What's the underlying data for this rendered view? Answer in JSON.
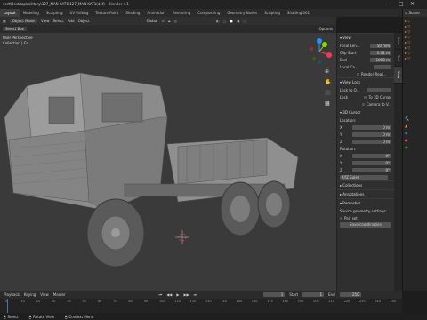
{
  "window": {
    "title": "vert\\Desktop\\military\\127_MAN KAT1\\127_MAN KAT1(def) - Blender 4.1"
  },
  "workspaces": {
    "tabs": [
      "Layout",
      "Modeling",
      "Sculpting",
      "UV Editing",
      "Texture Paint",
      "Shading",
      "Animation",
      "Rendering",
      "Compositing",
      "Geometry Nodes",
      "Scripting",
      "Shading.001"
    ],
    "active": 0
  },
  "header": {
    "view_menu": "View",
    "select_menu": "Select",
    "add_menu": "Add",
    "object_menu": "Object",
    "mode": "Object Mode",
    "orientation": "Global",
    "pivot": "Default",
    "drag": "Select Box",
    "options": "Options"
  },
  "viewport": {
    "label": "User Perspective",
    "collection": "Collection | Ga",
    "bg_color": "#3a3a3a"
  },
  "npanel": {
    "tabs": [
      "Item",
      "Tool",
      "View"
    ],
    "view_section": {
      "title": "View",
      "focal_label": "Focal Len...",
      "focal_value": "50 mm",
      "clip_start_label": "Clip Start",
      "clip_start_value": "0.01 m",
      "end_label": "End",
      "end_value": "1000 m",
      "local_camera_label": "Local Ca...",
      "render_region": "Render Regi..."
    },
    "view_lock": {
      "title": "View Lock",
      "lock_obj_label": "Lock to O...",
      "lock_label": "Lock",
      "to_cursor": "To 3D Cursor",
      "camera_to": "Camera to V..."
    },
    "cursor_section": {
      "title": "3D Cursor",
      "location": "Location:",
      "x_label": "X",
      "x_value": "0 m",
      "y_label": "Y",
      "y_value": "0 m",
      "z_label": "Z",
      "z_value": "0 m",
      "rotation": "Rotation:",
      "rx_label": "X",
      "rx_value": "0°",
      "ry_label": "Y",
      "ry_value": "0°",
      "rz_label": "Z",
      "rz_value": "0°",
      "mode": "XYZ Euler"
    },
    "collections": "Collections",
    "annotations": "Annotations",
    "remesher": {
      "title": "Remesher",
      "geom_label": "Source geometry settings:",
      "pair_label": "Pair set",
      "btn": "Save coordination"
    }
  },
  "scene": {
    "label": "Scene"
  },
  "timeline": {
    "playback": "Playback",
    "keying": "Keying",
    "view": "View",
    "marker": "Marker",
    "frame": "1",
    "start_label": "Start",
    "start_value": "1",
    "end_label": "End",
    "end_value": "250"
  },
  "ruler": {
    "ticks": [
      "0",
      "10",
      "20",
      "30",
      "40",
      "50",
      "60",
      "70",
      "80",
      "90",
      "100",
      "110",
      "120",
      "130",
      "140",
      "150",
      "160",
      "170",
      "180",
      "190",
      "200",
      "210",
      "220",
      "230",
      "240",
      "250"
    ]
  },
  "status": {
    "select": "Select",
    "rotate": "Rotate View",
    "context": "Context Menu"
  },
  "colors": {
    "accent": "#4772b3",
    "x_axis": "#ff3352",
    "y_axis": "#8bdc00",
    "z_axis": "#2890ff"
  }
}
